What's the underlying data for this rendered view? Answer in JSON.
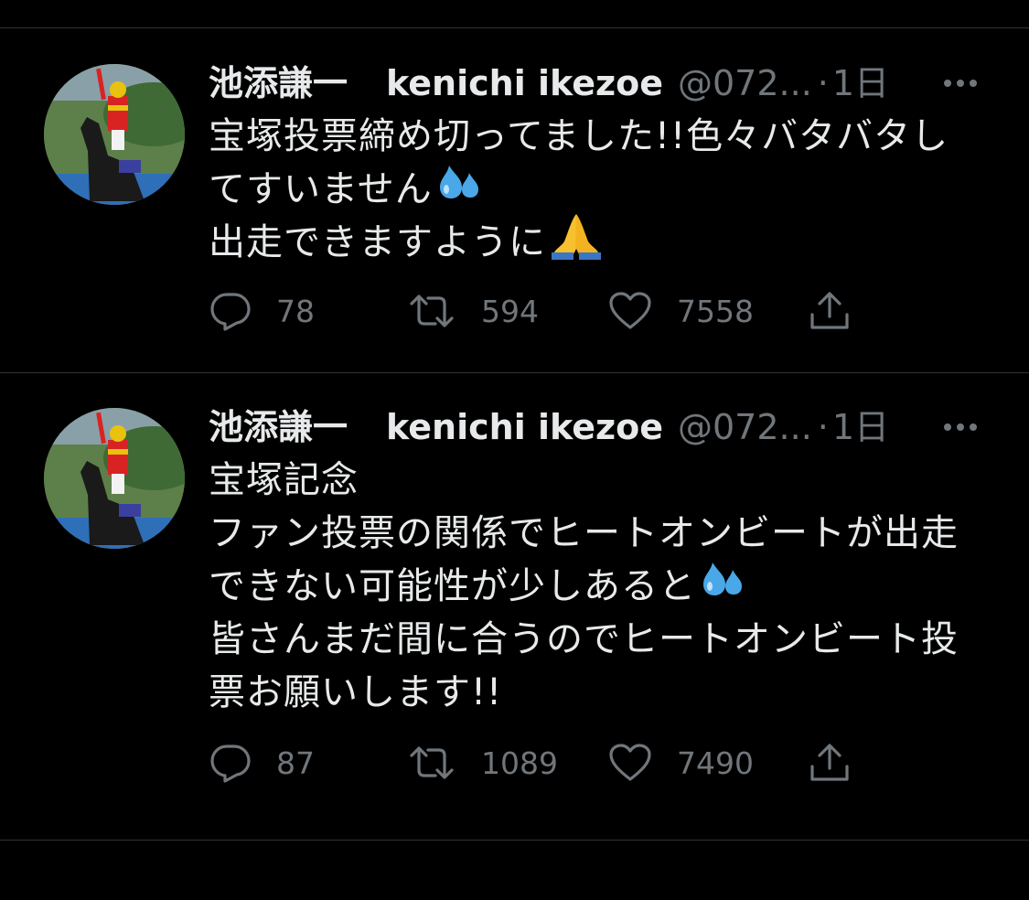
{
  "tweets": [
    {
      "display_name": "池添謙一",
      "display_name_en": "kenichi ikezoe",
      "handle": "@072...",
      "separator": "·",
      "time": "1日",
      "lines": [
        {
          "text": "宝塚投票締め切ってました!!色々バタバタし",
          "emoji": ""
        },
        {
          "text": "てすいません",
          "emoji": "sweat-droplets"
        },
        {
          "text": "出走できますように",
          "emoji": "folded-hands"
        }
      ],
      "replies": "78",
      "retweets": "594",
      "likes": "7558"
    },
    {
      "display_name": "池添謙一",
      "display_name_en": "kenichi ikezoe",
      "handle": "@072...",
      "separator": "·",
      "time": "1日",
      "lines": [
        {
          "text": "宝塚記念",
          "emoji": ""
        },
        {
          "text": "ファン投票の関係でヒートオンビートが出走",
          "emoji": ""
        },
        {
          "text": "できない可能性が少しあると",
          "emoji": "sweat-droplets"
        },
        {
          "text": "皆さんまだ間に合うのでヒートオンビート投",
          "emoji": ""
        },
        {
          "text": "票お願いします!!",
          "emoji": ""
        }
      ],
      "replies": "87",
      "retweets": "1089",
      "likes": "7490"
    }
  ],
  "colors": {
    "background": "#000000",
    "text": "#e7e9ea",
    "muted": "#71767b",
    "divider": "#2f3336"
  }
}
